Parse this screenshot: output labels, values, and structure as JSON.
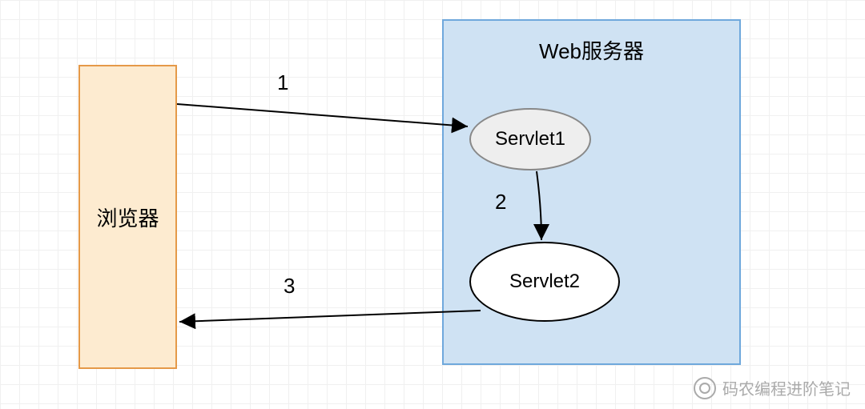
{
  "nodes": {
    "browser": {
      "label": "浏览器"
    },
    "server": {
      "title": "Web服务器"
    },
    "servlet1": {
      "label": "Servlet1"
    },
    "servlet2": {
      "label": "Servlet2"
    }
  },
  "edges": {
    "e1": {
      "label": "1",
      "from": "browser",
      "to": "servlet1"
    },
    "e2": {
      "label": "2",
      "from": "servlet1",
      "to": "servlet2"
    },
    "e3": {
      "label": "3",
      "from": "servlet2",
      "to": "browser"
    }
  },
  "watermark": {
    "text": "码农编程进阶笔记"
  },
  "colors": {
    "browser_fill": "#fdebd0",
    "browser_border": "#e59948",
    "server_fill": "#cfe2f3",
    "server_border": "#6fa8dc",
    "servlet1_fill": "#eeeeee",
    "servlet2_fill": "#ffffff"
  }
}
